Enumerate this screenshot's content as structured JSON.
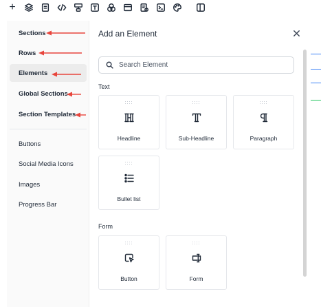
{
  "toolbar": {
    "icons": [
      "plus-icon",
      "layers-icon",
      "page-icon",
      "code-icon",
      "sections-icon",
      "text-icon",
      "shapes-icon",
      "browser-icon",
      "form-icon",
      "terminal-icon",
      "palette-icon",
      "panels-icon"
    ],
    "plus_glyph": "+"
  },
  "sidebar": {
    "items": [
      {
        "label": "Sections"
      },
      {
        "label": "Rows"
      },
      {
        "label": "Elements"
      },
      {
        "label": "Global Sections"
      },
      {
        "label": "Section Templates"
      },
      {
        "label": "Buttons"
      },
      {
        "label": "Social Media Icons"
      },
      {
        "label": "Images"
      },
      {
        "label": "Progress Bar"
      }
    ],
    "active_item": "Elements",
    "annotation_color": "#e8453c"
  },
  "panel": {
    "title": "Add an Element",
    "close_glyph": "×",
    "search_placeholder": "Search Element",
    "groups": [
      {
        "label": "Text",
        "elements": [
          {
            "label": "Headline",
            "icon": "headline-icon",
            "glyph": "H"
          },
          {
            "label": "Sub-Headline",
            "icon": "sub-headline-icon",
            "glyph": "T"
          },
          {
            "label": "Paragraph",
            "icon": "paragraph-icon",
            "glyph": "¶"
          },
          {
            "label": "Bullet list",
            "icon": "bullet-list-icon",
            "glyph": ""
          }
        ]
      },
      {
        "label": "Form",
        "elements": [
          {
            "label": "Button",
            "icon": "button-icon",
            "glyph": ""
          },
          {
            "label": "Form",
            "icon": "form-icon",
            "glyph": ""
          }
        ]
      }
    ],
    "grip_glyph": "::::"
  },
  "colors": {
    "accent_arrow": "#e8453c",
    "sidebar_bg": "#fafafa",
    "active_bg": "#ececec",
    "edge_blue": "#3b82f6",
    "edge_green": "#22c55e"
  }
}
